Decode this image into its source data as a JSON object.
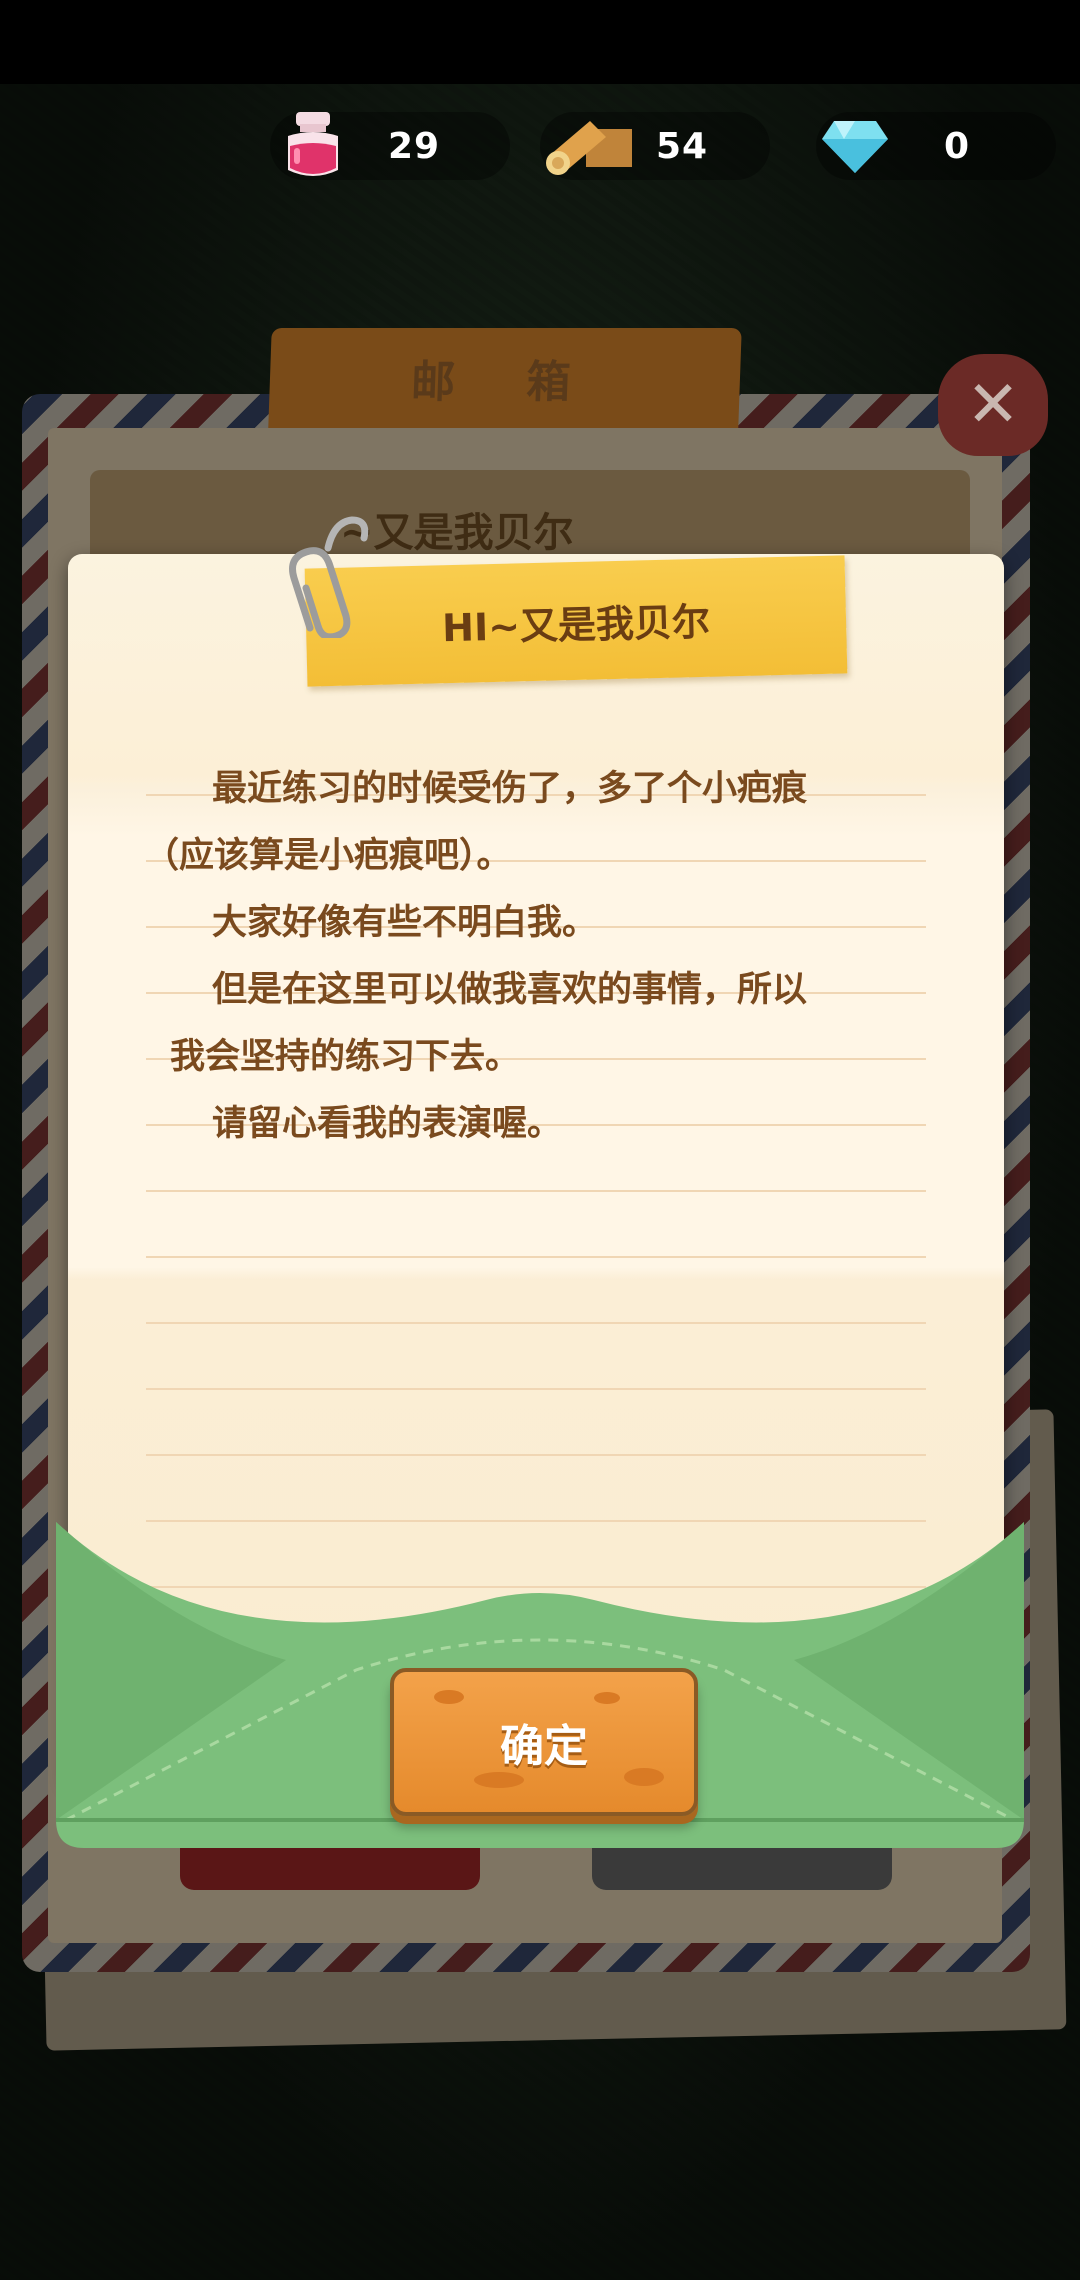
{
  "resources": [
    {
      "icon": "potion-icon",
      "value": "29"
    },
    {
      "icon": "wood-log-icon",
      "value": "54"
    },
    {
      "icon": "diamond-icon",
      "value": "0"
    }
  ],
  "mailbox": {
    "title": "邮 箱",
    "item_title": "~又是我贝尔"
  },
  "letter": {
    "title": "HI~又是我贝尔",
    "paragraphs": [
      "最近练习的时候受伤了，多了个小疤痕",
      "（应该算是小疤痕吧）。",
      "大家好像有些不明白我。",
      "但是在这里可以做我喜欢的事情，所以",
      "我会坚持的练习下去。",
      "请留心看我的表演喔。"
    ],
    "confirm_label": "确定"
  },
  "colors": {
    "tape": "#f3be36",
    "text": "#7a4a1e",
    "envelope": "#7cbf7c",
    "button": "#e58a2c"
  }
}
